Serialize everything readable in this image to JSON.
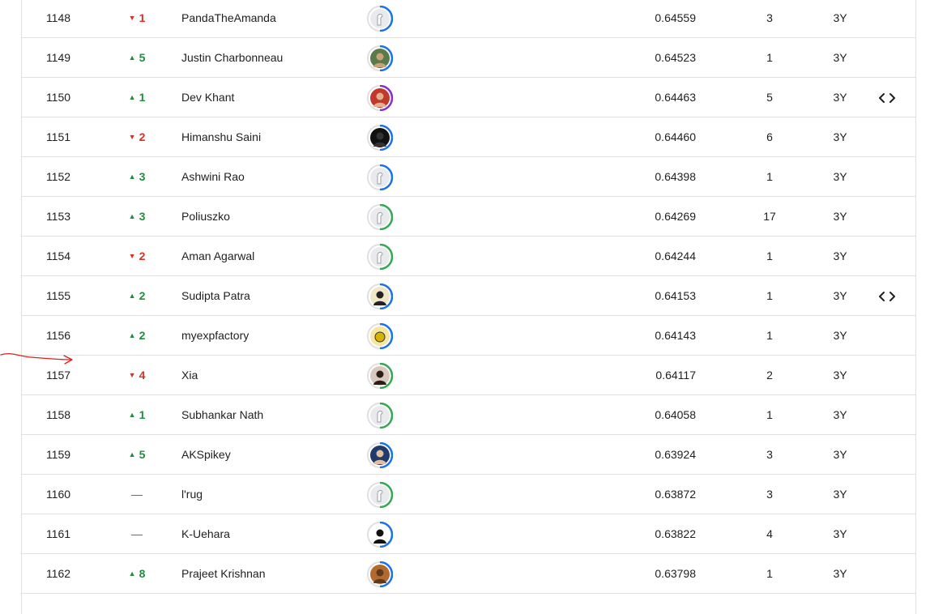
{
  "leaderboard": {
    "rows": [
      {
        "rank": "1148",
        "change": "1",
        "dir": "down",
        "name": "PandaTheAmanda",
        "score": "0.64559",
        "entries": "3",
        "last": "3Y",
        "code": false,
        "avatar": {
          "kind": "default",
          "ring": "#1a73e8",
          "bg": "#e8eaed"
        }
      },
      {
        "rank": "1149",
        "change": "5",
        "dir": "up",
        "name": "Justin Charbonneau",
        "score": "0.64523",
        "entries": "1",
        "last": "3Y",
        "code": false,
        "avatar": {
          "kind": "photo",
          "ring": "#1a73e8",
          "bg": "#5a7a4a",
          "fg": "#c9a27a"
        }
      },
      {
        "rank": "1150",
        "change": "1",
        "dir": "up",
        "name": "Dev Khant",
        "score": "0.64463",
        "entries": "5",
        "last": "3Y",
        "code": true,
        "avatar": {
          "kind": "photo",
          "ring": "#8430ce",
          "bg": "#c0392b",
          "fg": "#e0b090"
        }
      },
      {
        "rank": "1151",
        "change": "2",
        "dir": "down",
        "name": "Himanshu Saini",
        "score": "0.64460",
        "entries": "6",
        "last": "3Y",
        "code": false,
        "avatar": {
          "kind": "photo",
          "ring": "#1a73e8",
          "bg": "#111111",
          "fg": "#333333"
        }
      },
      {
        "rank": "1152",
        "change": "3",
        "dir": "up",
        "name": "Ashwini Rao",
        "score": "0.64398",
        "entries": "1",
        "last": "3Y",
        "code": false,
        "avatar": {
          "kind": "default",
          "ring": "#1a73e8",
          "bg": "#e8eaed"
        }
      },
      {
        "rank": "1153",
        "change": "3",
        "dir": "up",
        "name": "Poliuszko",
        "score": "0.64269",
        "entries": "17",
        "last": "3Y",
        "code": false,
        "avatar": {
          "kind": "default",
          "ring": "#34a853",
          "bg": "#e8eaed"
        }
      },
      {
        "rank": "1154",
        "change": "2",
        "dir": "down",
        "name": "Aman Agarwal",
        "score": "0.64244",
        "entries": "1",
        "last": "3Y",
        "code": false,
        "avatar": {
          "kind": "default",
          "ring": "#34a853",
          "bg": "#e8eaed"
        }
      },
      {
        "rank": "1155",
        "change": "2",
        "dir": "up",
        "name": "Sudipta Patra",
        "score": "0.64153",
        "entries": "1",
        "last": "3Y",
        "code": true,
        "avatar": {
          "kind": "photo",
          "ring": "#1a73e8",
          "bg": "#f1e6c8",
          "fg": "#222222"
        }
      },
      {
        "rank": "1156",
        "change": "2",
        "dir": "up",
        "name": "myexpfactory",
        "score": "0.64143",
        "entries": "1",
        "last": "3Y",
        "code": false,
        "avatar": {
          "kind": "bee",
          "ring": "#1a73e8",
          "bg": "#f5e6a0",
          "fg": "#d4b400"
        }
      },
      {
        "rank": "1157",
        "change": "4",
        "dir": "down",
        "name": "Xia",
        "score": "0.64117",
        "entries": "2",
        "last": "3Y",
        "code": false,
        "avatar": {
          "kind": "photo",
          "ring": "#34a853",
          "bg": "#d8c8c0",
          "fg": "#2b1d18"
        }
      },
      {
        "rank": "1158",
        "change": "1",
        "dir": "up",
        "name": "Subhankar Nath",
        "score": "0.64058",
        "entries": "1",
        "last": "3Y",
        "code": false,
        "avatar": {
          "kind": "default",
          "ring": "#34a853",
          "bg": "#e8eaed"
        }
      },
      {
        "rank": "1159",
        "change": "5",
        "dir": "up",
        "name": "AKSpikey",
        "score": "0.63924",
        "entries": "3",
        "last": "3Y",
        "code": false,
        "avatar": {
          "kind": "photo",
          "ring": "#1a73e8",
          "bg": "#1f3a6b",
          "fg": "#e0c0a0"
        }
      },
      {
        "rank": "1160",
        "change": "—",
        "dir": "same",
        "name": "l'rug",
        "score": "0.63872",
        "entries": "3",
        "last": "3Y",
        "code": false,
        "avatar": {
          "kind": "default",
          "ring": "#34a853",
          "bg": "#e8eaed"
        }
      },
      {
        "rank": "1161",
        "change": "—",
        "dir": "same",
        "name": "K-Uehara",
        "score": "0.63822",
        "entries": "4",
        "last": "3Y",
        "code": false,
        "avatar": {
          "kind": "photo",
          "ring": "#1a73e8",
          "bg": "#ffffff",
          "fg": "#111111"
        }
      },
      {
        "rank": "1162",
        "change": "8",
        "dir": "up",
        "name": "Prajeet Krishnan",
        "score": "0.63798",
        "entries": "1",
        "last": "3Y",
        "code": false,
        "avatar": {
          "kind": "photo",
          "ring": "#1a73e8",
          "bg": "#b36a2e",
          "fg": "#5a3a20"
        }
      }
    ]
  },
  "colors": {
    "up": "#1e8e3e",
    "down": "#d93025",
    "annotation": "#e02020"
  }
}
